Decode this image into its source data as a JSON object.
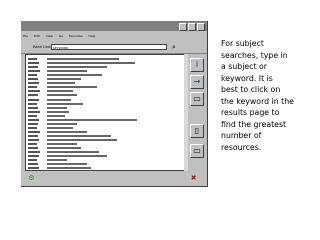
{
  "window": {
    "menu": [
      "File",
      "Edit",
      "View",
      "Go",
      "Favorites",
      "Help"
    ]
  },
  "toolbar": {
    "search_label": "Read Line:",
    "search_value": "KEYWORD"
  },
  "side_buttons": [
    {
      "icon": "info-icon",
      "glyph": "i"
    },
    {
      "icon": "arrow-right-icon",
      "glyph": "→"
    },
    {
      "icon": "box-icon",
      "glyph": "▭"
    },
    {
      "icon": "document-icon",
      "glyph": "▯"
    },
    {
      "icon": "paper-icon",
      "glyph": "▭"
    }
  ],
  "note": {
    "lines": [
      "For subject",
      "searches, type in",
      "a subject or",
      "keyword.  It is",
      "best to click on",
      "the keyword in the",
      "results page to",
      "find the greatest",
      "number of",
      "resources."
    ]
  }
}
